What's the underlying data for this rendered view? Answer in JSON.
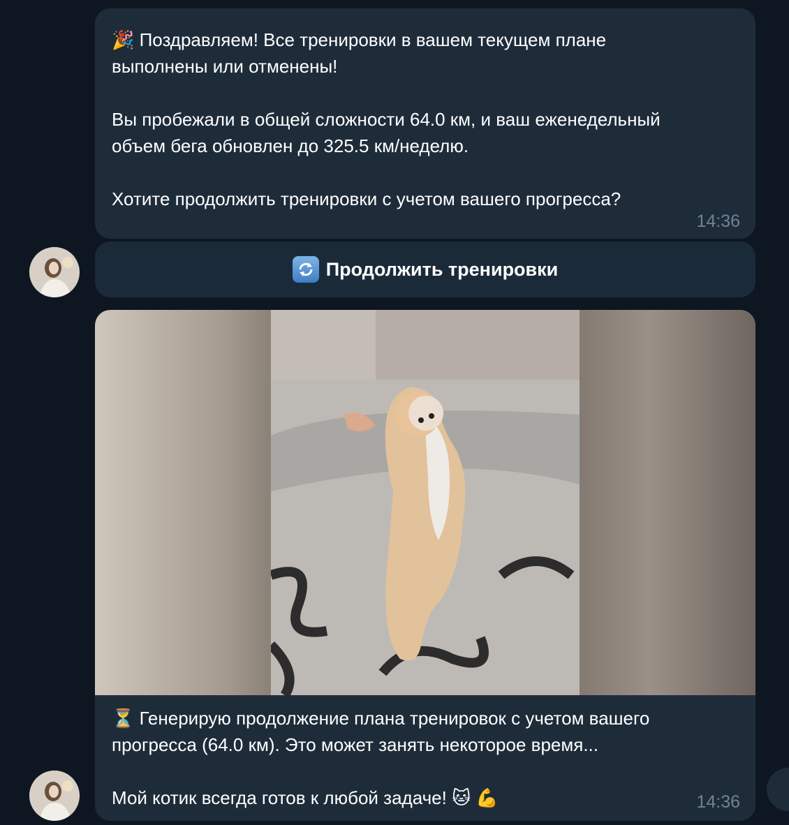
{
  "messages": [
    {
      "text": "🎉 Поздравляем! Все тренировки в вашем текущем плане\nвыполнены или отменены!\n\nВы пробежали в общей сложности 64.0 км, и ваш еженедельный\nобъем бега обновлен до 325.5 км/неделю.\n\nХотите продолжить тренировки с учетом вашего прогресса?",
      "time": "14:36"
    },
    {
      "text": "⏳ Генерирую продолжение плана тренировок с учетом вашего\nпрогресса (64.0 км). Это может занять некоторое время...\n\nМой котик всегда готов к любой задаче! 🐱 💪",
      "time": "14:36"
    }
  ],
  "inline_button": {
    "icon": "refresh-icon",
    "label": "Продолжить тренировки"
  },
  "media": {
    "type": "video",
    "subject": "kitten-standing-photo"
  },
  "colors": {
    "background": "#0e1621",
    "bubble": "#1e2c3a",
    "time": "#6f8396"
  }
}
